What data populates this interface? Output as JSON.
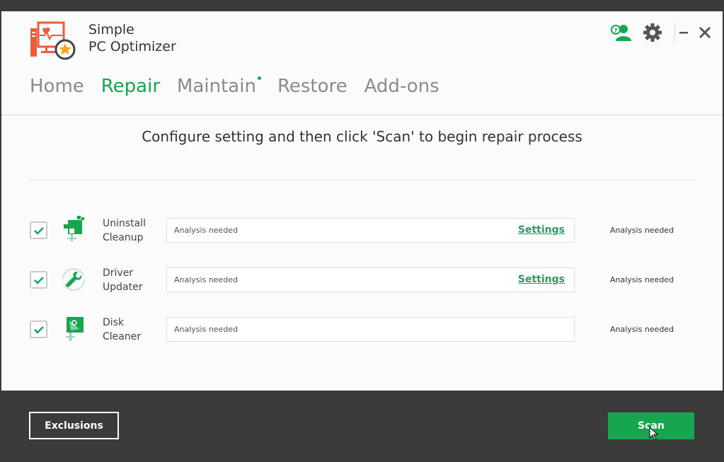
{
  "app": {
    "name_line1": "Simple",
    "name_line2": "PC Optimizer"
  },
  "header_icons": [
    "support-icon",
    "gear-icon",
    "minimize-icon",
    "close-icon"
  ],
  "nav": {
    "items": [
      {
        "label": "Home",
        "active": false
      },
      {
        "label": "Repair",
        "active": true
      },
      {
        "label": "Maintain",
        "active": false,
        "notification_dot": true
      },
      {
        "label": "Restore",
        "active": false
      },
      {
        "label": "Add-ons",
        "active": false
      }
    ]
  },
  "main": {
    "heading": "Configure setting and then click 'Scan' to begin repair process",
    "rows": [
      {
        "label_line1": "Uninstall",
        "label_line2": "Cleanup",
        "checked": true,
        "icon": "uninstall-cleanup-icon",
        "status": "Analysis needed",
        "settings_label": "Settings",
        "result": "Analysis needed"
      },
      {
        "label_line1": "Driver",
        "label_line2": "Updater",
        "checked": true,
        "icon": "driver-updater-icon",
        "status": "Analysis needed",
        "settings_label": "Settings",
        "result": "Analysis needed"
      },
      {
        "label_line1": "Disk",
        "label_line2": "Cleaner",
        "checked": true,
        "icon": "disk-cleaner-icon",
        "status": "Analysis needed",
        "result": "Analysis needed"
      }
    ]
  },
  "footer": {
    "exclusions_label": "Exclusions",
    "scan_label": "Scan"
  },
  "colors": {
    "accent": "#17a550",
    "footer_bg": "#3b3b3b",
    "logo_orange": "#ef5a3c"
  }
}
